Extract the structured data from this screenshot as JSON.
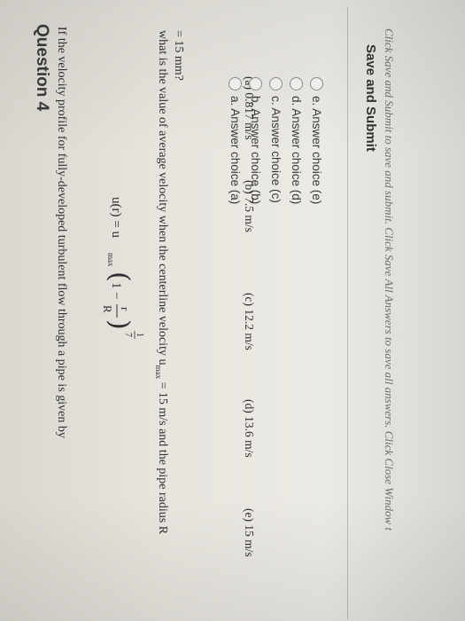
{
  "question": {
    "title": "Question 4",
    "line1": "If the velocity profile for fully-developed turbulent flow through a pipe is given by",
    "formula_lhs": "u(r) = u",
    "formula_sub": "max",
    "formula_inner": "1 − ",
    "formula_r": "r",
    "formula_R": "R",
    "formula_exp_num": "1",
    "formula_exp_den": "7",
    "line2": "what is the value of average velocity when the centerline velocity u",
    "line2_sub": "max",
    "line2_rest": " = 15 m/s and the pipe radius R",
    "line3": "= 15 mm?"
  },
  "choices": [
    {
      "key": "(a)",
      "text": "0.817 m/s"
    },
    {
      "key": "(b)",
      "text": "7.5 m/s"
    },
    {
      "key": "(c)",
      "text": "12.2 m/s"
    },
    {
      "key": "(d)",
      "text": "13.6 m/s"
    },
    {
      "key": "(e)",
      "text": "15 m/s"
    }
  ],
  "answers": [
    {
      "label": "a. Answer choice (a)"
    },
    {
      "label": "b. Answer choice (b)"
    },
    {
      "label": "c. Answer choice (c)"
    },
    {
      "label": "d. Answer choice (d)"
    },
    {
      "label": "e. Answer choice (e)"
    }
  ],
  "save": {
    "title": "Save and Submit",
    "instructions": "Click Save and Submit to save and submit. Click Save All Answers to save all answers. Click Close Window t"
  }
}
